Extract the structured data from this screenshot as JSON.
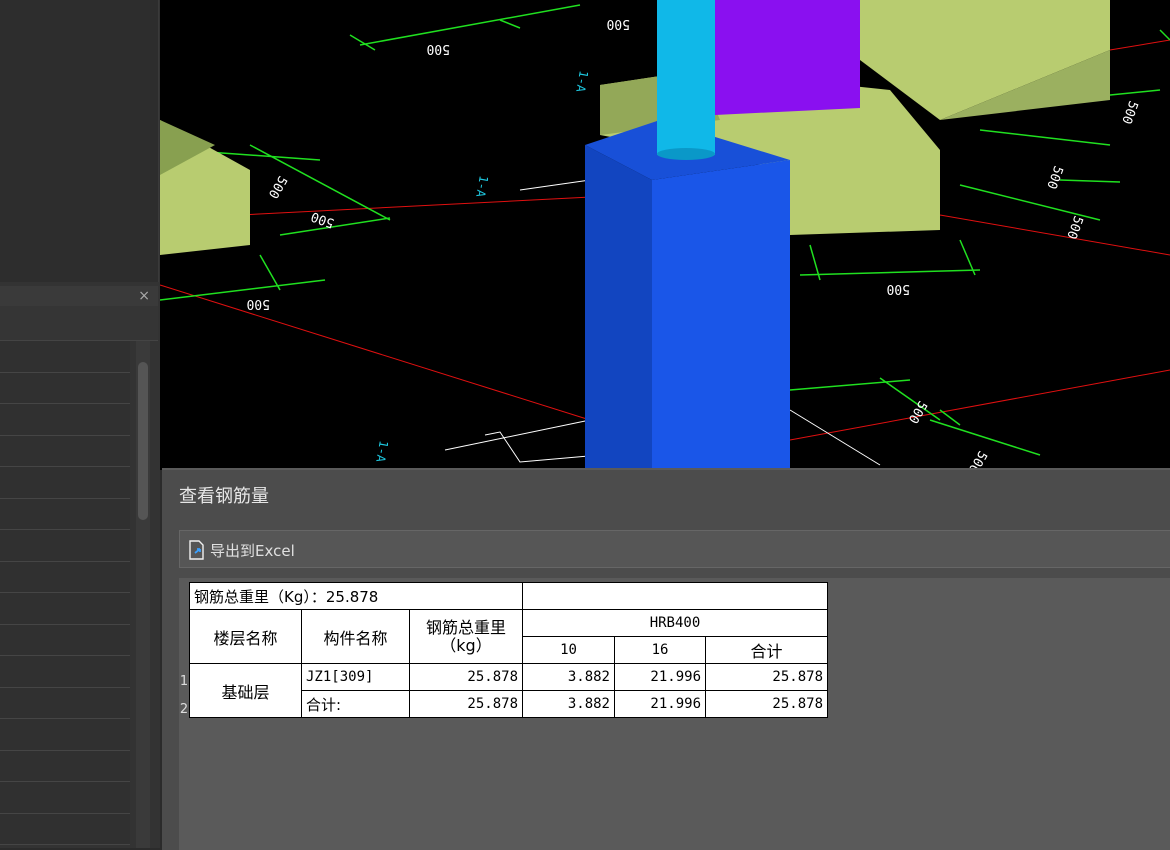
{
  "dialog": {
    "title": "查看钢筋量",
    "export_button": "导出到Excel"
  },
  "left_panel": {
    "close_icon": "×"
  },
  "viewport": {
    "dimension_labels": [
      "500",
      "500",
      "500",
      "500",
      "500",
      "500",
      "500",
      "500",
      "500",
      "500",
      "500"
    ],
    "axis_labels": [
      "1-A",
      "1-A",
      "1-A"
    ]
  },
  "rebar_table": {
    "total_label": "钢筋总重里（Kg）：25.878",
    "headers": {
      "floor": "楼层名称",
      "component": "构件名称",
      "total_weight": "钢筋总重里（kg）",
      "grade": "HRB400",
      "dia_10": "10",
      "dia_16": "16",
      "subtotal": "合计"
    },
    "row_numbers": [
      "1",
      "2"
    ],
    "floor_name": "基础层",
    "rows": [
      {
        "component": "JZ1[309]",
        "total": "25.878",
        "d10": "3.882",
        "d16": "21.996",
        "sum": "25.878"
      },
      {
        "component": "合计:",
        "total": "25.878",
        "d10": "3.882",
        "d16": "21.996",
        "sum": "25.878"
      }
    ]
  },
  "colors": {
    "column_blue": "#1a56e8",
    "beam_cyan": "#10b8e8",
    "column_purple": "#8a10f0",
    "cap_green": "#b8cc70",
    "dim_green": "#20e020",
    "grid_red": "#e01010"
  }
}
